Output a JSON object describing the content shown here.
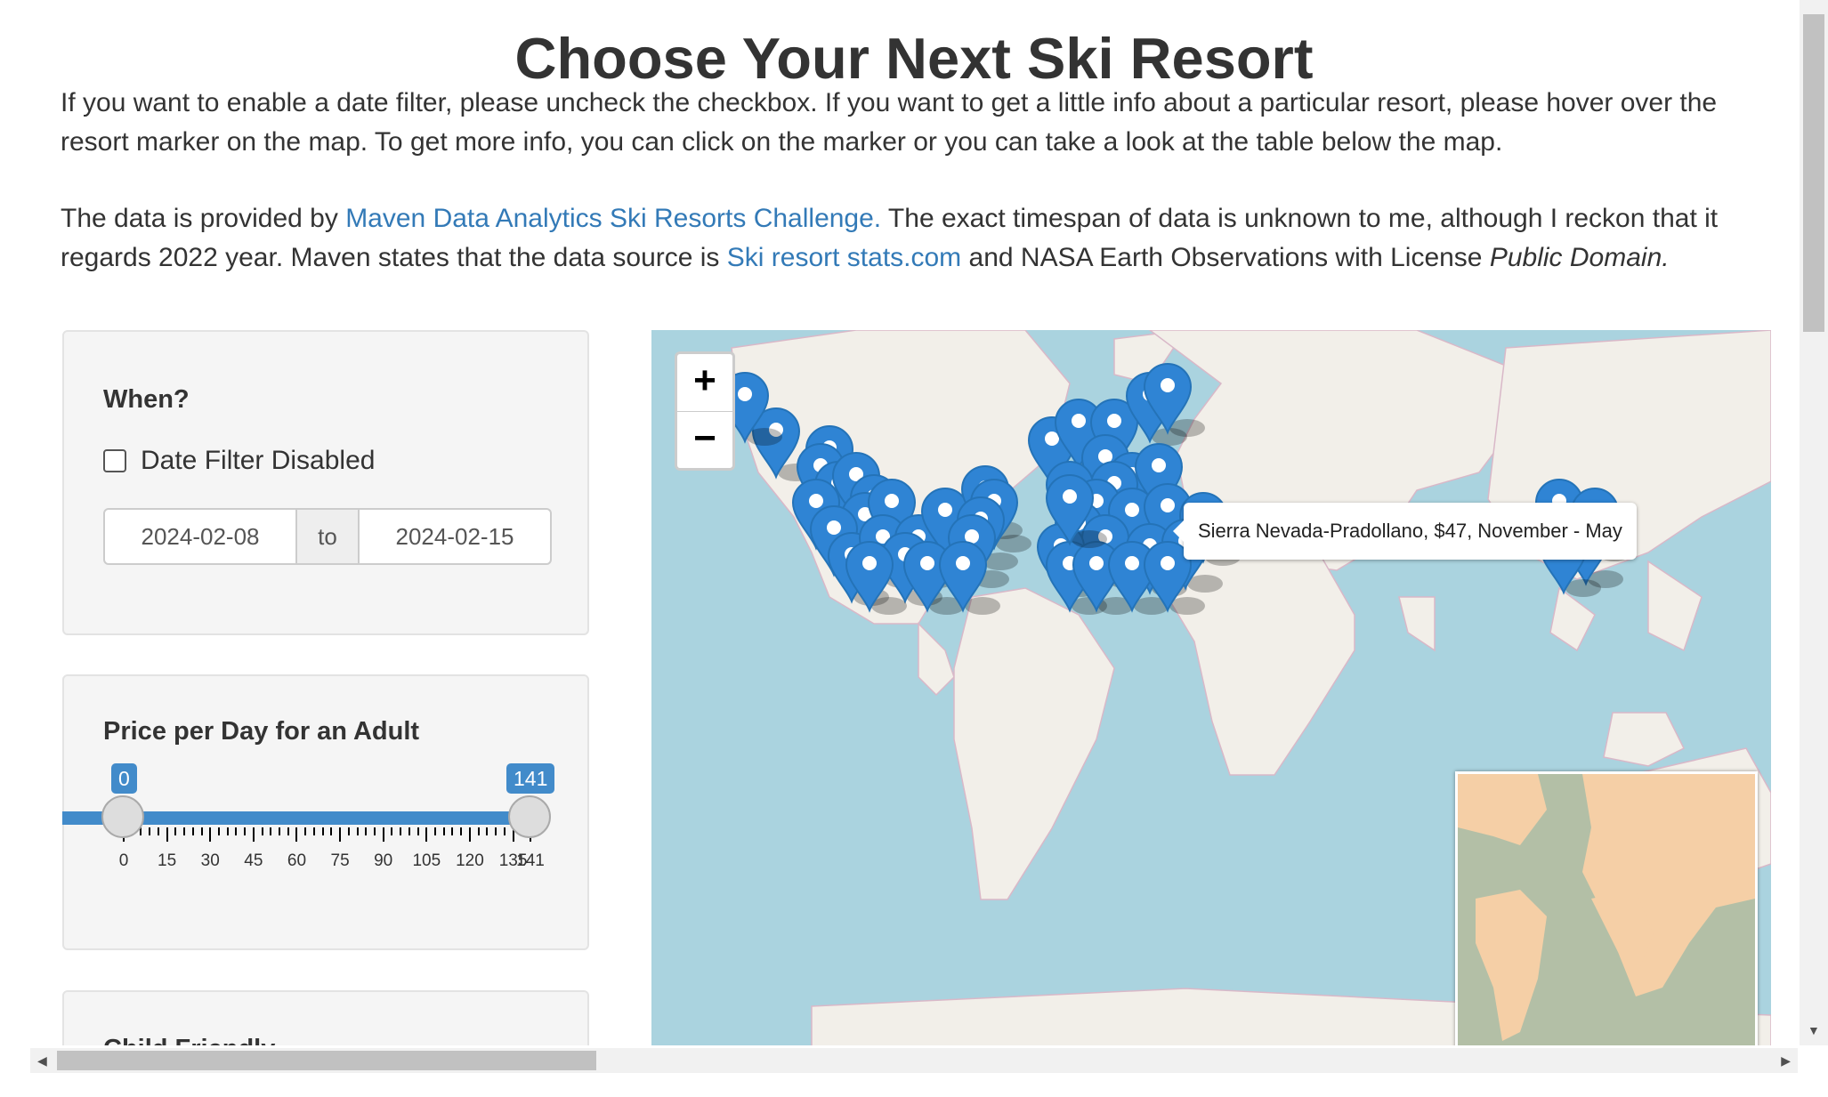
{
  "header": {
    "title": "Choose Your Next Ski Resort"
  },
  "intro": {
    "p1": "If you want to enable a date filter, please uncheck the checkbox. If you want to get a little info about a particular resort, please hover over the resort marker on the map. To get more info, you can click on the marker or you can take a look at the table below the map.",
    "p2_before": "The data is provided by ",
    "p2_link1": "Maven Data Analytics Ski Resorts Challenge.",
    "p2_middle": " The exact timespan of data is unknown to me, although I reckon that it regards 2022 year. Maven states that the data source is ",
    "p2_link2": "Ski resort stats.com",
    "p2_after": " and NASA Earth Observations with License ",
    "p2_italic": "Public Domain."
  },
  "when_panel": {
    "label": "When?",
    "checkbox_label": "Date Filter Disabled",
    "checkbox_checked": false,
    "date_start": "2024-02-08",
    "date_sep": "to",
    "date_end": "2024-02-15"
  },
  "price_panel": {
    "label": "Price per Day for an Adult",
    "min_value": "0",
    "max_value": "141",
    "range_min": 0,
    "range_max": 141,
    "ticks": [
      "0",
      "15",
      "30",
      "45",
      "60",
      "75",
      "90",
      "105",
      "120",
      "135",
      "141"
    ]
  },
  "child_panel": {
    "label": "Child Friendly"
  },
  "map": {
    "zoom_in": "+",
    "zoom_out": "−",
    "tooltip": "Sierra Nevada-Pradollano, $47, November - May",
    "water_color": "#aad3df",
    "land_color": "#f2efe9",
    "marker_color": "#2f84d4",
    "minimap_land": "#f5cfa6",
    "minimap_water": "#b3bfa6"
  },
  "colors": {
    "accent": "#337ab7",
    "slider": "#428bca"
  }
}
